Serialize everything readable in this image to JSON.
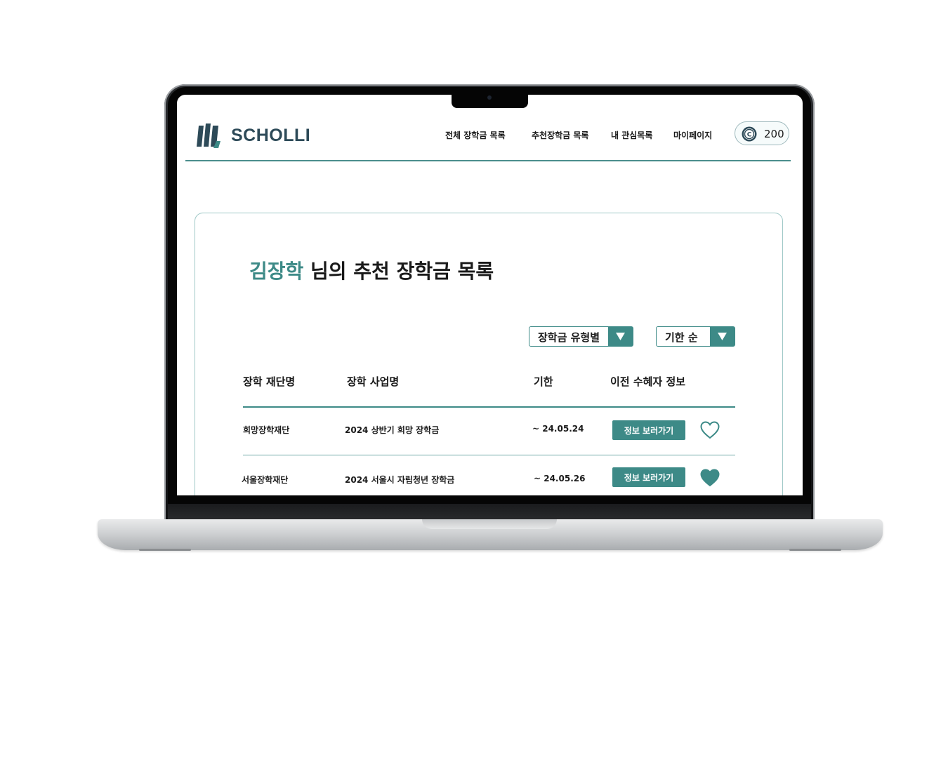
{
  "brand": {
    "name": "SCHOLLI"
  },
  "nav": {
    "items": [
      {
        "label": "전체 장학금 목록"
      },
      {
        "label": "추천장학금 목록"
      },
      {
        "label": "내 관심목록"
      },
      {
        "label": "마이페이지"
      }
    ]
  },
  "coins": {
    "icon": "coin-icon",
    "value": "200"
  },
  "page": {
    "user_name": "김장학",
    "title_suffix": " 님의 추천 장학금 목록"
  },
  "filters": {
    "type": {
      "label": "장학금 유형별",
      "icon": "triangle-down-icon"
    },
    "sort": {
      "label": "기한 순",
      "icon": "triangle-down-icon"
    }
  },
  "table": {
    "headers": [
      "장학 재단명",
      "장학 사업명",
      "기한",
      "이전 수혜자 정보"
    ],
    "rows": [
      {
        "foundation": "희망장학재단",
        "program": "2024 상반기 희망 장학금",
        "deadline": "~ 24.05.24",
        "button": "정보 보러가기",
        "favorited": false
      },
      {
        "foundation": "서울장학재단",
        "program": "2024 서울시 자립청년 장학금",
        "deadline": "~ 24.05.26",
        "button": "정보 보러가기",
        "favorited": true
      }
    ]
  },
  "colors": {
    "accent": "#3d8a87",
    "brand_text": "#2d4a58",
    "text": "#1a1a1a"
  }
}
